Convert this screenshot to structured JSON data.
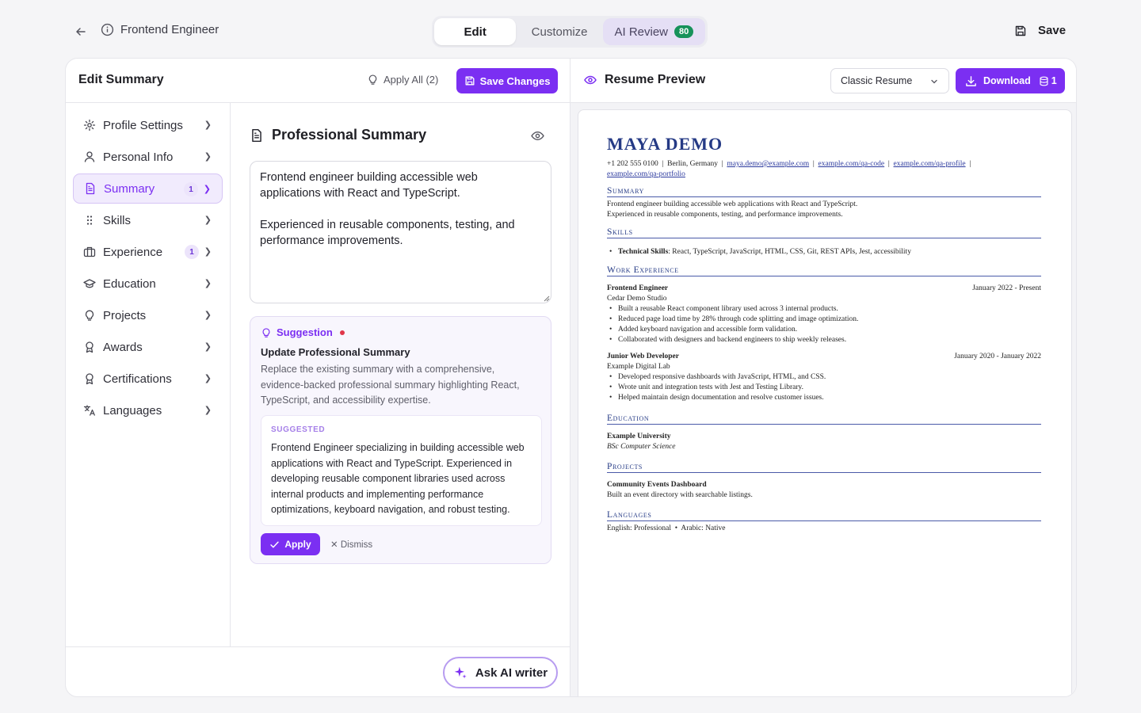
{
  "header": {
    "job_title": "Frontend Engineer",
    "tabs": [
      {
        "label": "Edit"
      },
      {
        "label": "Customize"
      },
      {
        "label": "AI Review",
        "badge": "80"
      }
    ],
    "save_label": "Save"
  },
  "editor": {
    "title": "Edit Summary",
    "apply_all": "Apply All (2)",
    "save_changes": "Save Changes",
    "nav": [
      {
        "label": "Profile Settings",
        "icon": "gear-icon"
      },
      {
        "label": "Personal Info",
        "icon": "user-icon"
      },
      {
        "label": "Summary",
        "icon": "document-icon",
        "count": "1",
        "active": true
      },
      {
        "label": "Skills",
        "icon": "grip-icon"
      },
      {
        "label": "Experience",
        "icon": "briefcase-icon",
        "count": "1"
      },
      {
        "label": "Education",
        "icon": "graduation-cap-icon"
      },
      {
        "label": "Projects",
        "icon": "lightbulb-icon"
      },
      {
        "label": "Awards",
        "icon": "award-icon"
      },
      {
        "label": "Certifications",
        "icon": "certificate-icon"
      },
      {
        "label": "Languages",
        "icon": "translate-icon"
      }
    ],
    "section_title": "Professional Summary",
    "summary_text": "Frontend engineer building accessible web applications with React and TypeScript.\n\nExperienced in reusable components, testing, and performance improvements.",
    "suggestion": {
      "label": "Suggestion",
      "title": "Update Professional Summary",
      "description": "Replace the existing summary with a comprehensive, evidence-backed professional summary highlighting React, TypeScript, and accessibility expertise.",
      "suggested_label": "SUGGESTED",
      "suggested_text": "Frontend Engineer specializing in building accessible web applications with React and TypeScript. Experienced in developing reusable component libraries used across internal products and implementing performance optimizations, keyboard navigation, and robust testing.",
      "apply": "Apply",
      "dismiss": "Dismiss"
    },
    "ask_ai": "Ask AI writer"
  },
  "preview": {
    "title": "Resume Preview",
    "template": "Classic Resume",
    "download": "Download",
    "download_count": "1",
    "resume": {
      "name": "MAYA DEMO",
      "phone": "+1 202 555 0100",
      "location": "Berlin, Germany",
      "email": "maya.demo@example.com",
      "link1": "example.com/qa-code",
      "link2": "example.com/qa-profile",
      "link3": "example.com/qa-portfolio",
      "summary_h": "Summary",
      "summary_1": "Frontend engineer building accessible web applications with React and TypeScript.",
      "summary_2": "Experienced in reusable components, testing, and performance improvements.",
      "skills_h": "Skills",
      "skills_label": "Technical Skills",
      "skills_text": ": React, TypeScript, JavaScript, HTML, CSS, Git, REST APIs, Jest, accessibility",
      "work_h": "Work Experience",
      "jobs": [
        {
          "title": "Frontend Engineer",
          "dates": "January 2022 - Present",
          "company": "Cedar Demo Studio",
          "bullets": [
            "Built a reusable React component library used across 3 internal products.",
            "Reduced page load time by 28% through code splitting and image optimization.",
            "Added keyboard navigation and accessible form validation.",
            "Collaborated with designers and backend engineers to ship weekly releases."
          ]
        },
        {
          "title": "Junior Web Developer",
          "dates": "January 2020 - January 2022",
          "company": "Example Digital Lab",
          "bullets": [
            "Developed responsive dashboards with JavaScript, HTML, and CSS.",
            "Wrote unit and integration tests with Jest and Testing Library.",
            "Helped maintain design documentation and resolve customer issues."
          ]
        }
      ],
      "education_h": "Education",
      "school": "Example University",
      "degree": "BSc Computer Science",
      "projects_h": "Projects",
      "project_name": "Community Events Dashboard",
      "project_desc": "Built an event directory with searchable listings.",
      "languages_h": "Languages",
      "lang_1": "English: Professional",
      "lang_2": "Arabic: Native"
    }
  },
  "colors": {
    "accent": "#7b2ff2",
    "badge_green": "#17925a",
    "resume_blue": "#253a85"
  }
}
